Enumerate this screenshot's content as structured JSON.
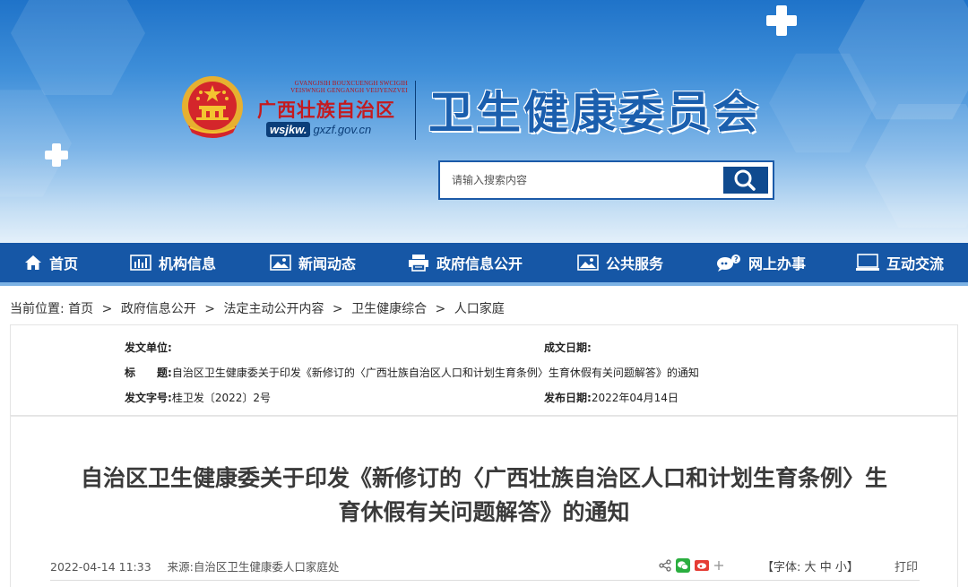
{
  "header": {
    "zhuang_line1": "GVANGJSIH BOUXCUENGH SWCIGIH",
    "zhuang_line2": "VEISWNGH GENGANGH VEIJYENZVEI",
    "region_name": "广西壮族自治区",
    "domain_prefix": "wsjkw.",
    "domain_rest": "gxzf.gov.cn",
    "site_title": "卫生健康委员会",
    "search_placeholder": "请输入搜索内容"
  },
  "nav": {
    "items": [
      {
        "label": "首页",
        "icon": "home-icon"
      },
      {
        "label": "机构信息",
        "icon": "bar-chart-icon"
      },
      {
        "label": "新闻动态",
        "icon": "image-icon"
      },
      {
        "label": "政府信息公开",
        "icon": "printer-icon"
      },
      {
        "label": "公共服务",
        "icon": "image-icon"
      },
      {
        "label": "网上办事",
        "icon": "chat-icon"
      },
      {
        "label": "互动交流",
        "icon": "monitor-icon"
      }
    ]
  },
  "breadcrumb": {
    "prefix": "当前位置:",
    "items": [
      "首页",
      "政府信息公开",
      "法定主动公开内容",
      "卫生健康综合",
      "人口家庭"
    ],
    "separator": ">"
  },
  "info": {
    "issuer_label": "发文单位:",
    "issuer_value": "",
    "written_date_label": "成文日期:",
    "written_date_value": "",
    "title_label": "标　　题:",
    "title_value": "自治区卫生健康委关于印发《新修订的〈广西壮族自治区人口和计划生育条例〉生育休假有关问题解答》的通知",
    "doc_no_label": "发文字号:",
    "doc_no_value": "桂卫发〔2022〕2号",
    "publish_date_label": "发布日期:",
    "publish_date_value": "2022年04月14日"
  },
  "article": {
    "title_line1": "自治区卫生健康委关于印发《新修订的〈广西壮族自治区人口和计划生育条例〉生",
    "title_line2": "育休假有关问题解答》的通知",
    "datetime": "2022-04-14 11:33",
    "source_label": "来源:",
    "source_value": "自治区卫生健康委人口家庭处",
    "font_label_open": "【字体:",
    "font_large": "大",
    "font_medium": "中",
    "font_small": "小】",
    "print_label": "打印"
  },
  "colors": {
    "nav_bg": "#1657a6",
    "title_blue": "#1b5fae",
    "emblem_red": "#c41a1f"
  }
}
